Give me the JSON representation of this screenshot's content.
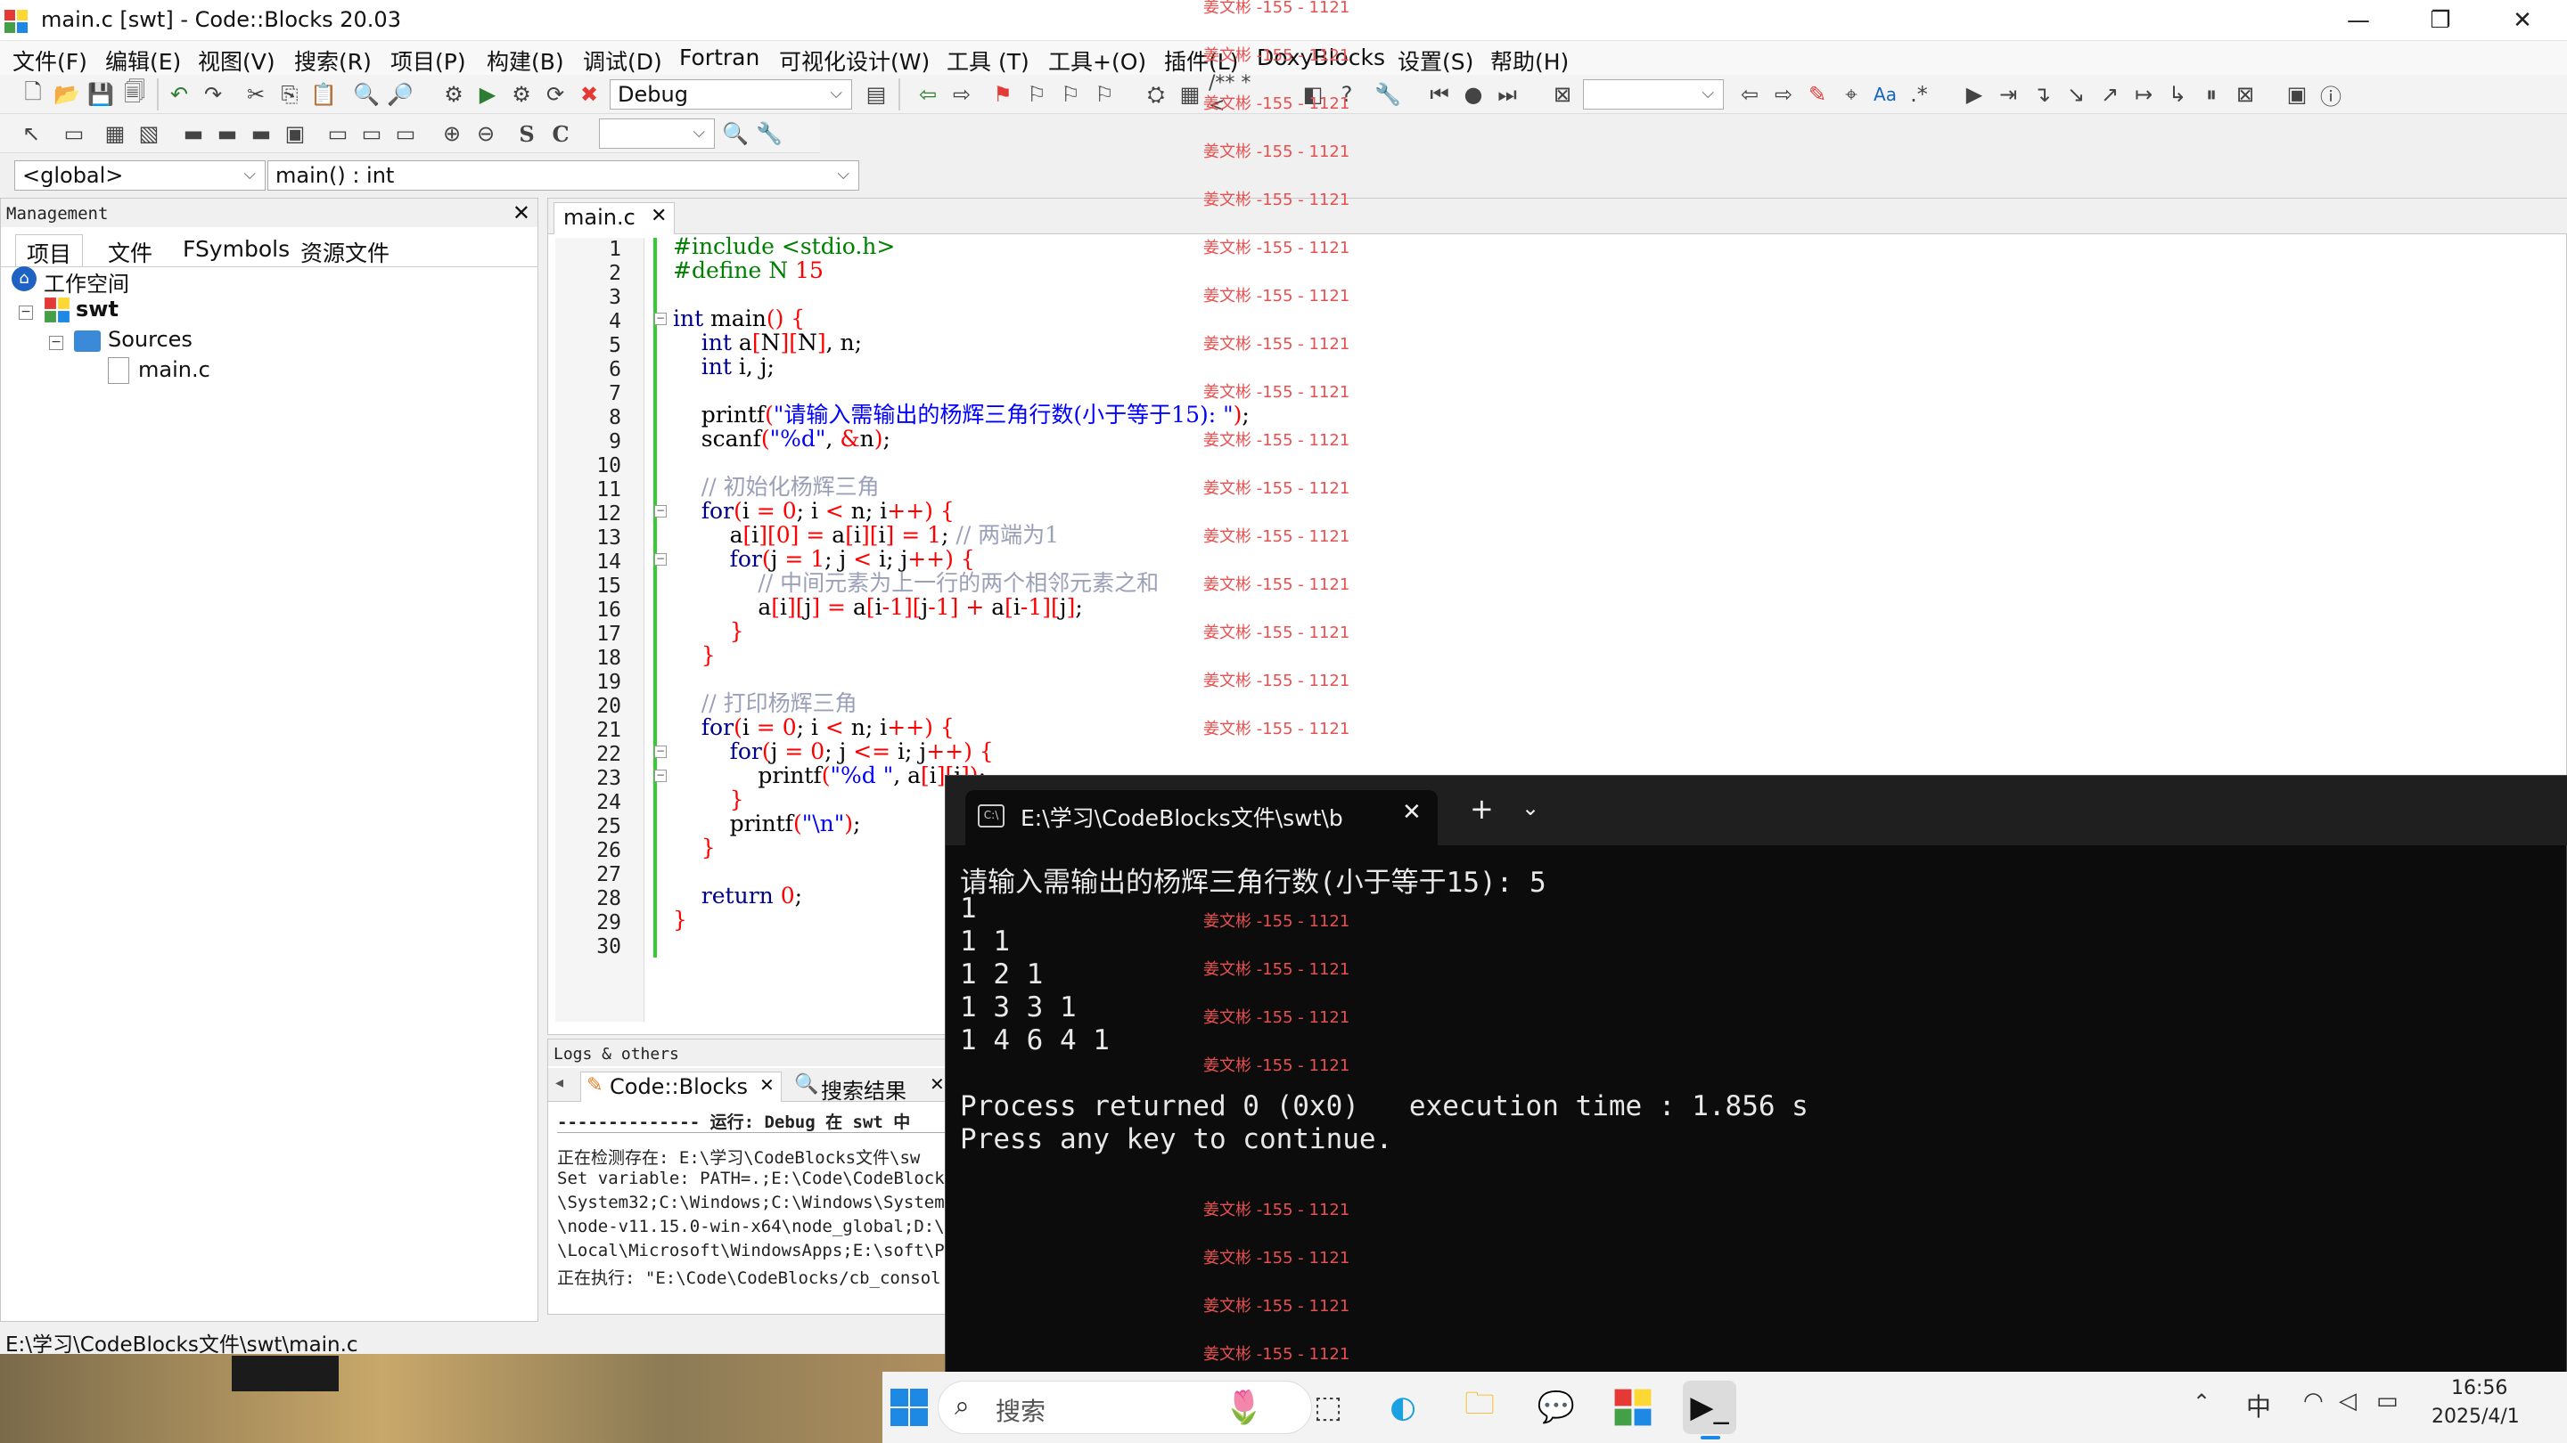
{
  "window": {
    "title": "main.c [swt] - Code::Blocks 20.03",
    "minimize_icon": "minimize-icon",
    "maximize_icon": "restore-icon",
    "close_icon": "close-icon"
  },
  "menu": [
    "文件(F)",
    "编辑(E)",
    "视图(V)",
    "搜索(R)",
    "项目(P)",
    "构建(B)",
    "调试(D)",
    "Fortran",
    "可视化设计(W)",
    "工具 (T)",
    "工具+(O)",
    "插件(L)",
    "DoxyBlocks",
    "设置(S)",
    "帮助(H)"
  ],
  "toolbar": {
    "build_target": "Debug",
    "scope_global": "<global>",
    "scope_function": "main() : int"
  },
  "management": {
    "title": "Management",
    "tabs": [
      "项目",
      "文件",
      "FSymbols",
      "资源文件"
    ],
    "tree": {
      "workspace": "工作空间",
      "project": "swt",
      "folder": "Sources",
      "file": "main.c"
    }
  },
  "editor": {
    "tab_label": "main.c",
    "line_numbers": [
      "1",
      "2",
      "3",
      "4",
      "5",
      "6",
      "7",
      "8",
      "9",
      "10",
      "11",
      "12",
      "13",
      "14",
      "15",
      "16",
      "17",
      "18",
      "19",
      "20",
      "21",
      "22",
      "23",
      "24",
      "25",
      "26",
      "27",
      "28",
      "29",
      "30"
    ]
  },
  "logs": {
    "title": "Logs & others",
    "tabs": [
      "Code::Blocks",
      "搜索结果"
    ],
    "lines": [
      "-------------- 运行: Debug 在 swt 中",
      "正在检测存在:  E:\\学习\\CodeBlocks文件\\sw",
      "Set variable: PATH=.;E:\\Code\\CodeBlocks\\",
      "\\System32;C:\\Windows;C:\\Windows\\System32",
      "\\node-v11.15.0-win-x64\\node_global;D:\\i",
      "\\Local\\Microsoft\\WindowsApps;E:\\soft\\Py",
      "正在执行:  \"E:\\Code\\CodeBlocks/cb_consol"
    ]
  },
  "status_bar": "E:\\学习\\CodeBlocks文件\\swt\\main.c",
  "terminal": {
    "tab_title": "E:\\学习\\CodeBlocks文件\\swt\\b",
    "new_tab": "+",
    "output": [
      "请输入需输出的杨辉三角行数(小于等于15): 5",
      "1",
      "1 1",
      "1 2 1",
      "1 3 3 1",
      "1 4 6 4 1",
      "",
      "Process returned 0 (0x0)   execution time : 1.856 s",
      "Press any key to continue."
    ]
  },
  "taskbar": {
    "search_placeholder": "搜索",
    "time": "16:56",
    "date": "2025/4/1",
    "ime": "中"
  },
  "watermark": "姜文彬 -155 - 1121",
  "colors": {
    "keyword": "#00008b",
    "string": "#0000ff",
    "number": "#ff0000",
    "comment": "#9aa0b8",
    "terminal_bg": "#0c0c0c",
    "watermark": "#e85050"
  }
}
